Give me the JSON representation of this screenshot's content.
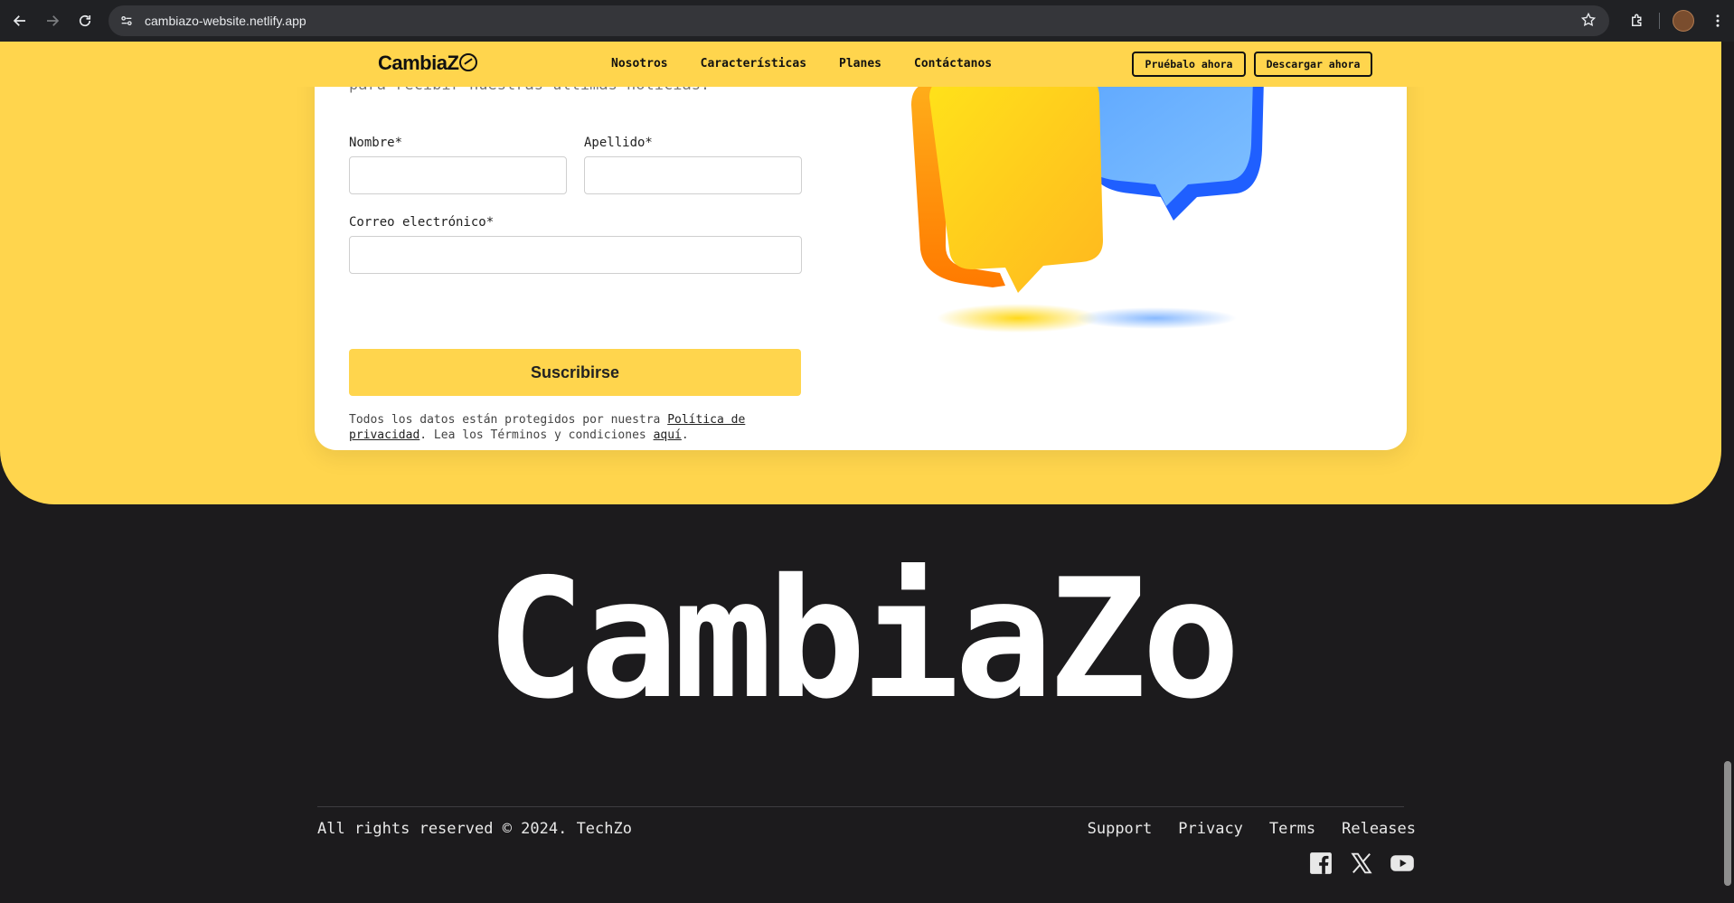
{
  "browser": {
    "url": "cambiazo-website.netlify.app"
  },
  "header": {
    "logo": "CambiaZ",
    "nav": [
      "Nosotros",
      "Características",
      "Planes",
      "Contáctanos"
    ],
    "try_label": "Pruébalo ahora",
    "download_label": "Descargar ahora"
  },
  "newsletter": {
    "intro_partial": "para recibir nuestras últimas noticias.",
    "first_name_label": "Nombre*",
    "last_name_label": "Apellido*",
    "email_label": "Correo electrónico*",
    "first_name_value": "",
    "last_name_value": "",
    "email_value": "",
    "submit_label": "Suscribirse",
    "legal_text_1": "Todos los datos están protegidos por nuestra ",
    "legal_link_privacy": "Política de privacidad",
    "legal_text_2": ". Lea los Términos y condiciones ",
    "legal_link_here": "aquí",
    "legal_text_3": "."
  },
  "footer": {
    "brand": "CambiaZo",
    "copyright": "All rights reserved © 2024. TechZo",
    "links": [
      "Support",
      "Privacy",
      "Terms",
      "Releases"
    ],
    "socials": [
      "facebook-icon",
      "x-icon",
      "youtube-icon"
    ]
  },
  "colors": {
    "brand_yellow": "#ffd54d",
    "footer_bg": "#1c1b1d",
    "bubble_yellow": "#ffd21f",
    "bubble_blue": "#4a9bff"
  }
}
